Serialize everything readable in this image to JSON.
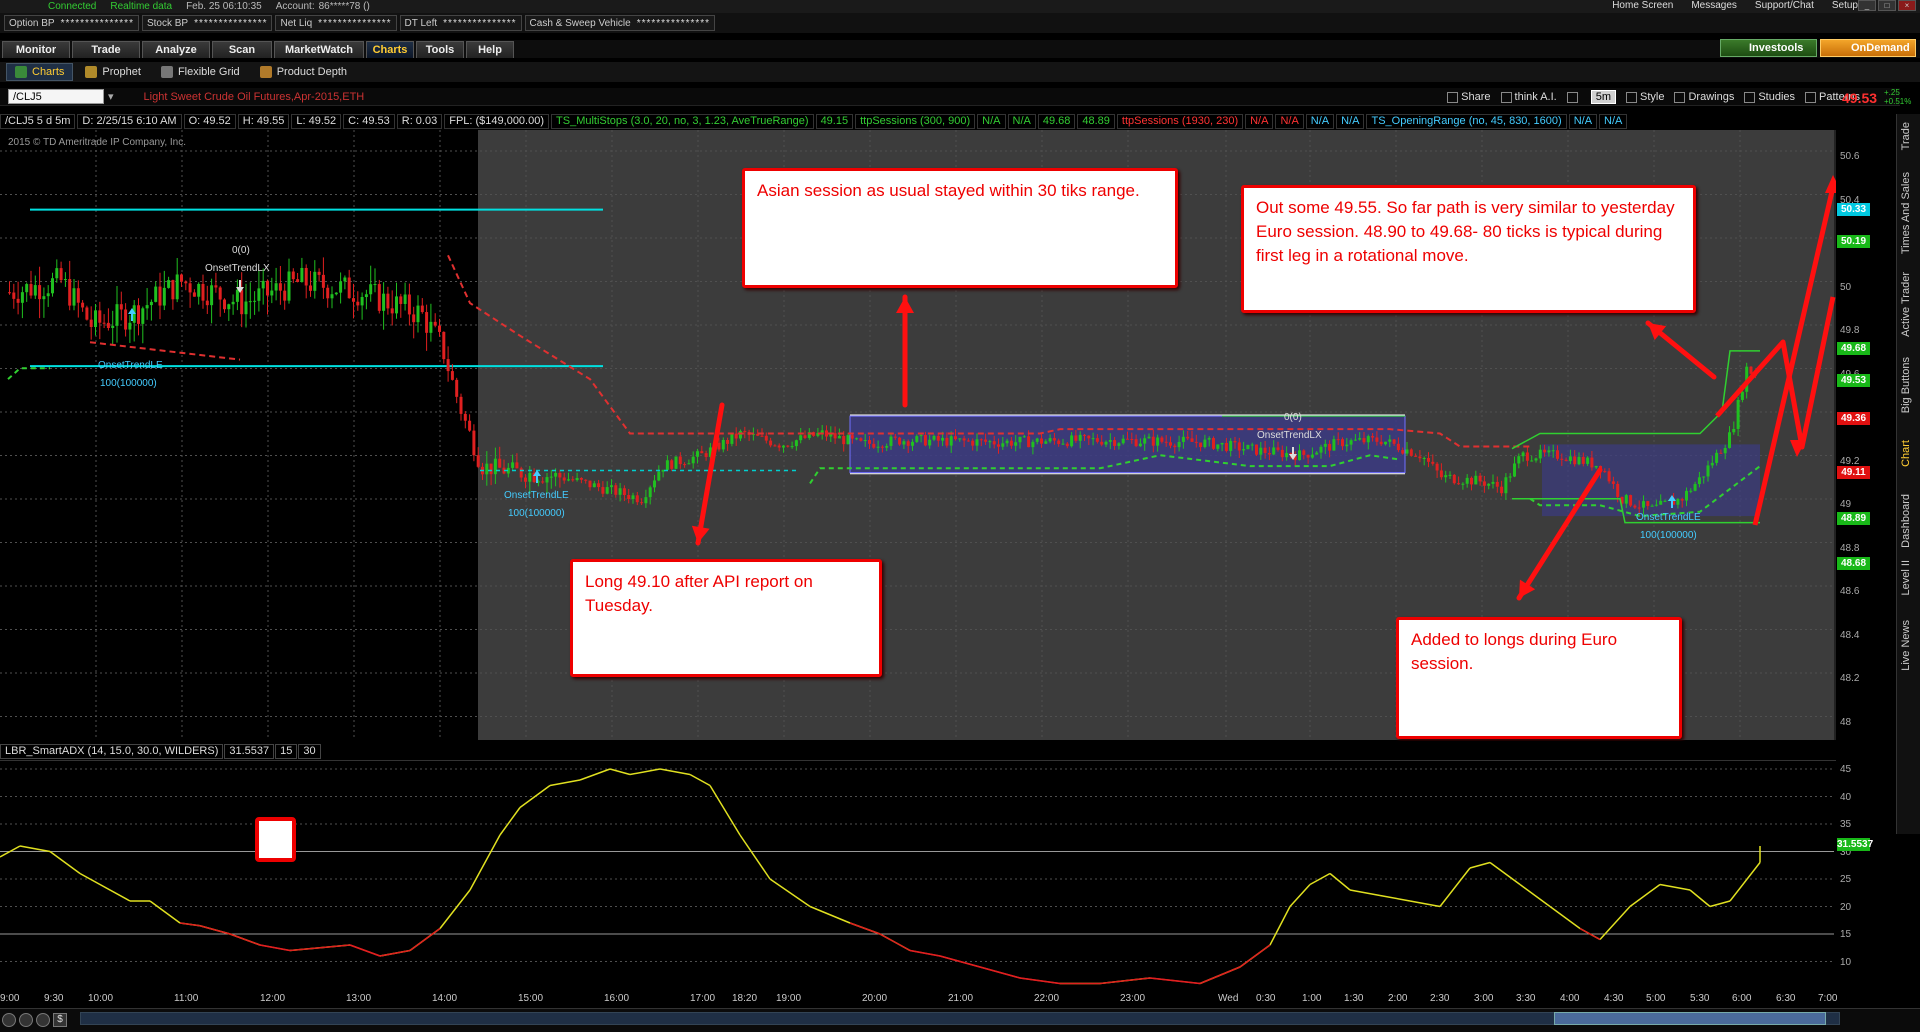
{
  "status": {
    "connected": "Connected",
    "realtime": "Realtime data",
    "datetime": "Feb. 25  06:10:35",
    "account_label": "Account:",
    "account_value": "86*****78 ()"
  },
  "account_bar": [
    {
      "label": "Option BP",
      "value": "***************"
    },
    {
      "label": "Stock BP",
      "value": "***************"
    },
    {
      "label": "Net Liq",
      "value": "***************"
    },
    {
      "label": "DT Left",
      "value": "***************"
    },
    {
      "label": "Cash & Sweep Vehicle",
      "value": "***************"
    }
  ],
  "top_right": {
    "home": "Home Screen",
    "messages": "Messages",
    "support": "Support/Chat",
    "setup": "Setup"
  },
  "tabs": [
    "Monitor",
    "Trade",
    "Analyze",
    "Scan",
    "MarketWatch",
    "Charts",
    "Tools",
    "Help"
  ],
  "active_tab": "Charts",
  "investools": "Investools",
  "ondemand": "OnDemand",
  "subtabs": [
    "Charts",
    "Prophet",
    "Flexible Grid",
    "Product Depth"
  ],
  "symbol": "/CLJ5",
  "symbol_desc": "Light Sweet Crude Oil Futures,Apr-2015,ETH",
  "chart_tools": {
    "share": "Share",
    "think": "think A.I.",
    "timeframe": "5m",
    "style": "Style",
    "drawings": "Drawings",
    "studies": "Studies",
    "patterns": "Patterns"
  },
  "last_price": "49.53",
  "change": {
    "abs": "+.25",
    "pct": "+0.51%"
  },
  "study_bar": [
    {
      "text": "/CLJ5 5 d 5m",
      "color": "w"
    },
    {
      "text": "D: 2/25/15 6:10 AM",
      "color": "w"
    },
    {
      "text": "O: 49.52",
      "color": "w"
    },
    {
      "text": "H: 49.55",
      "color": "w"
    },
    {
      "text": "L: 49.52",
      "color": "w"
    },
    {
      "text": "C: 49.53",
      "color": "w"
    },
    {
      "text": "R: 0.03",
      "color": "w"
    },
    {
      "text": "FPL: ($149,000.00)",
      "color": "w"
    },
    {
      "text": "TS_MultiStops (3.0, 20, no, 3, 1.23, AveTrueRange)",
      "color": "g"
    },
    {
      "text": "49.15",
      "color": "g"
    },
    {
      "text": "ttpSessions (300, 900)",
      "color": "g"
    },
    {
      "text": "N/A",
      "color": "g"
    },
    {
      "text": "N/A",
      "color": "g"
    },
    {
      "text": "49.68",
      "color": "g"
    },
    {
      "text": "48.89",
      "color": "g"
    },
    {
      "text": "ttpSessions (1930, 230)",
      "color": "r"
    },
    {
      "text": "N/A",
      "color": "r"
    },
    {
      "text": "N/A",
      "color": "r"
    },
    {
      "text": "N/A",
      "color": "c"
    },
    {
      "text": "N/A",
      "color": "c"
    },
    {
      "text": "TS_OpeningRange (no, 45, 830, 1600)",
      "color": "c"
    },
    {
      "text": "N/A",
      "color": "c"
    },
    {
      "text": "N/A",
      "color": "c"
    }
  ],
  "copyright": "2015 © TD Ameritrade IP Company, Inc.",
  "chart_labels": {
    "onset_lx_1_qty": "0(0)",
    "onset_lx_1": "OnsetTrendLX",
    "onset_le_1": "OnsetTrendLE",
    "onset_le_1_qty": "100(100000)",
    "onset_le_2": "OnsetTrendLE",
    "onset_le_2_qty": "100(100000)",
    "onset_lx_2_qty": "0(0)",
    "onset_lx_2": "OnsetTrendLX",
    "onset_le_3": "OnsetTrendLE",
    "onset_le_3_qty": "100(100000)"
  },
  "notes": {
    "asian": "Asian session as usual stayed within 30 tiks range.",
    "out": "Out some 49.55. So far path is very similar to yesterday Euro session. 48.90 to 49.68- 80 ticks  is typical during first leg in a rotational move.",
    "long": "Long 49.10 after API report on Tuesday.",
    "added": "Added to longs during Euro session."
  },
  "price_axis": [
    "50.6",
    "50.4",
    "50.2",
    "50",
    "49.8",
    "49.6",
    "49.4",
    "49.2",
    "49",
    "48.8",
    "48.6",
    "48.4",
    "48.2",
    "48"
  ],
  "price_tags": [
    {
      "text": "50.33",
      "color": "#00c8e0"
    },
    {
      "text": "50.19",
      "color": "#18b818"
    },
    {
      "text": "49.68",
      "color": "#18b818"
    },
    {
      "text": "49.53",
      "color": "#18b818"
    },
    {
      "text": "49.36",
      "color": "#e01010"
    },
    {
      "text": "49.11",
      "color": "#e01010"
    },
    {
      "text": "48.89",
      "color": "#18b818"
    },
    {
      "text": "48.68",
      "color": "#18b818"
    }
  ],
  "adx_bar": [
    {
      "text": "LBR_SmartADX (14, 15.0, 30.0, WILDERS)"
    },
    {
      "text": "31.5537"
    },
    {
      "text": "15"
    },
    {
      "text": "30"
    }
  ],
  "adx_axis": [
    "45",
    "40",
    "35",
    "30",
    "25",
    "20",
    "15",
    "10"
  ],
  "adx_tag": "31.5537",
  "time_axis": [
    "9:00",
    "9:30",
    "10:00",
    "11:00",
    "12:00",
    "13:00",
    "14:00",
    "15:00",
    "16:00",
    "17:00",
    "18:20",
    "19:00",
    "20:00",
    "21:00",
    "22:00",
    "23:00",
    "Wed",
    "0:30",
    "1:00",
    "1:30",
    "2:00",
    "2:30",
    "3:00",
    "3:30",
    "4:00",
    "4:30",
    "5:00",
    "5:30",
    "6:00",
    "6:30",
    "7:00"
  ],
  "side_tabs": [
    "Trade",
    "Times And Sales",
    "Active Trader",
    "Big Buttons",
    "Chart",
    "Dashboard",
    "Level II",
    "Live News"
  ],
  "active_side_tab": "Chart"
}
